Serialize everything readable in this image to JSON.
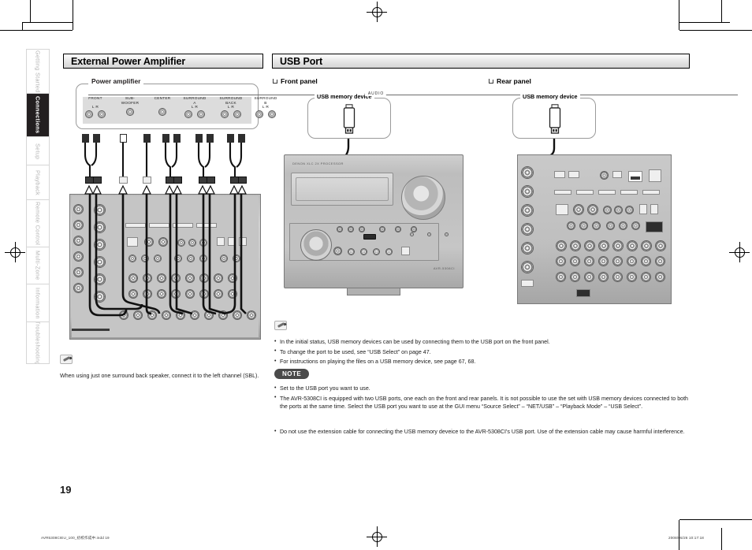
{
  "page": {
    "number": "19",
    "footer_left": "AVR5308CIEU_100_初校作成中.indd   19",
    "footer_right": "2008/05/26   10:17:18"
  },
  "sidebar": {
    "items": [
      {
        "label": "Getting Started",
        "active": false
      },
      {
        "label": "Connections",
        "active": true
      },
      {
        "label": "Setup",
        "active": false
      },
      {
        "label": "Playback",
        "active": false
      },
      {
        "label": "Remote Control",
        "active": false
      },
      {
        "label": "Multi-Zone",
        "active": false
      },
      {
        "label": "Information",
        "active": false
      },
      {
        "label": "Troubleshooting",
        "active": false
      }
    ]
  },
  "left_column": {
    "section_title": "External Power Amplifier",
    "diagram": {
      "device_label": "Power amplifier",
      "bus_label": "AUDIO",
      "groups": [
        {
          "name": "FRONT",
          "lr": "L    R",
          "jacks": 2
        },
        {
          "name": "SUB-\nWOOFER",
          "lr": "",
          "jacks": 1
        },
        {
          "name": "CENTER",
          "lr": "",
          "jacks": 1
        },
        {
          "name": "SURROUND\nA",
          "lr": "L    R",
          "jacks": 2
        },
        {
          "name": "SURROUND\nBACK",
          "lr": "L    R",
          "jacks": 2
        },
        {
          "name": "SURROUND\nB",
          "lr": "L    R",
          "jacks": 2
        }
      ]
    },
    "memo": {
      "icon": "pencil-memo-icon",
      "text": "When  using  just  one  surround  back  speaker,  connect  it  to  the  left channel (SBL)."
    }
  },
  "right_column": {
    "section_title": "USB Port",
    "panels": [
      {
        "heading": "Front panel",
        "device_label": "USB memory device"
      },
      {
        "heading": "Rear panel",
        "device_label": "USB memory device"
      }
    ],
    "memo": {
      "icon": "pencil-memo-icon",
      "items": [
        "In the initial status, USB memory devices can be used by connecting them to the USB port on the front panel.",
        "To change the port to be used, see “USB Select” on page 47.",
        "For instructions on playing the files on a USB memory device, see page 67, 68."
      ]
    },
    "note": {
      "badge": "NOTE",
      "items": [
        "Set to the USB port you want to use.",
        "The AVR-5308CI is equipped with two USB ports, one each on the front and rear panels. It is not possible to use the set with USB memory devices connected to both the ports at the same time. Select the USB port you want to use at the GUI menu “Source Select” – “NET/USB” – “Playback Mode” – “USB Select”.",
        "Do not use the extension cable for connecting the USB memory deveice to the AVR-5308CI’s USB port. Use of the extension cable may cause harmful interference."
      ]
    }
  },
  "colors": {
    "header_fill": "#d4d4d4",
    "active_tab": "#231f20",
    "note_badge": "#4a4a4a",
    "panel_gray": "#c5c5c5"
  }
}
